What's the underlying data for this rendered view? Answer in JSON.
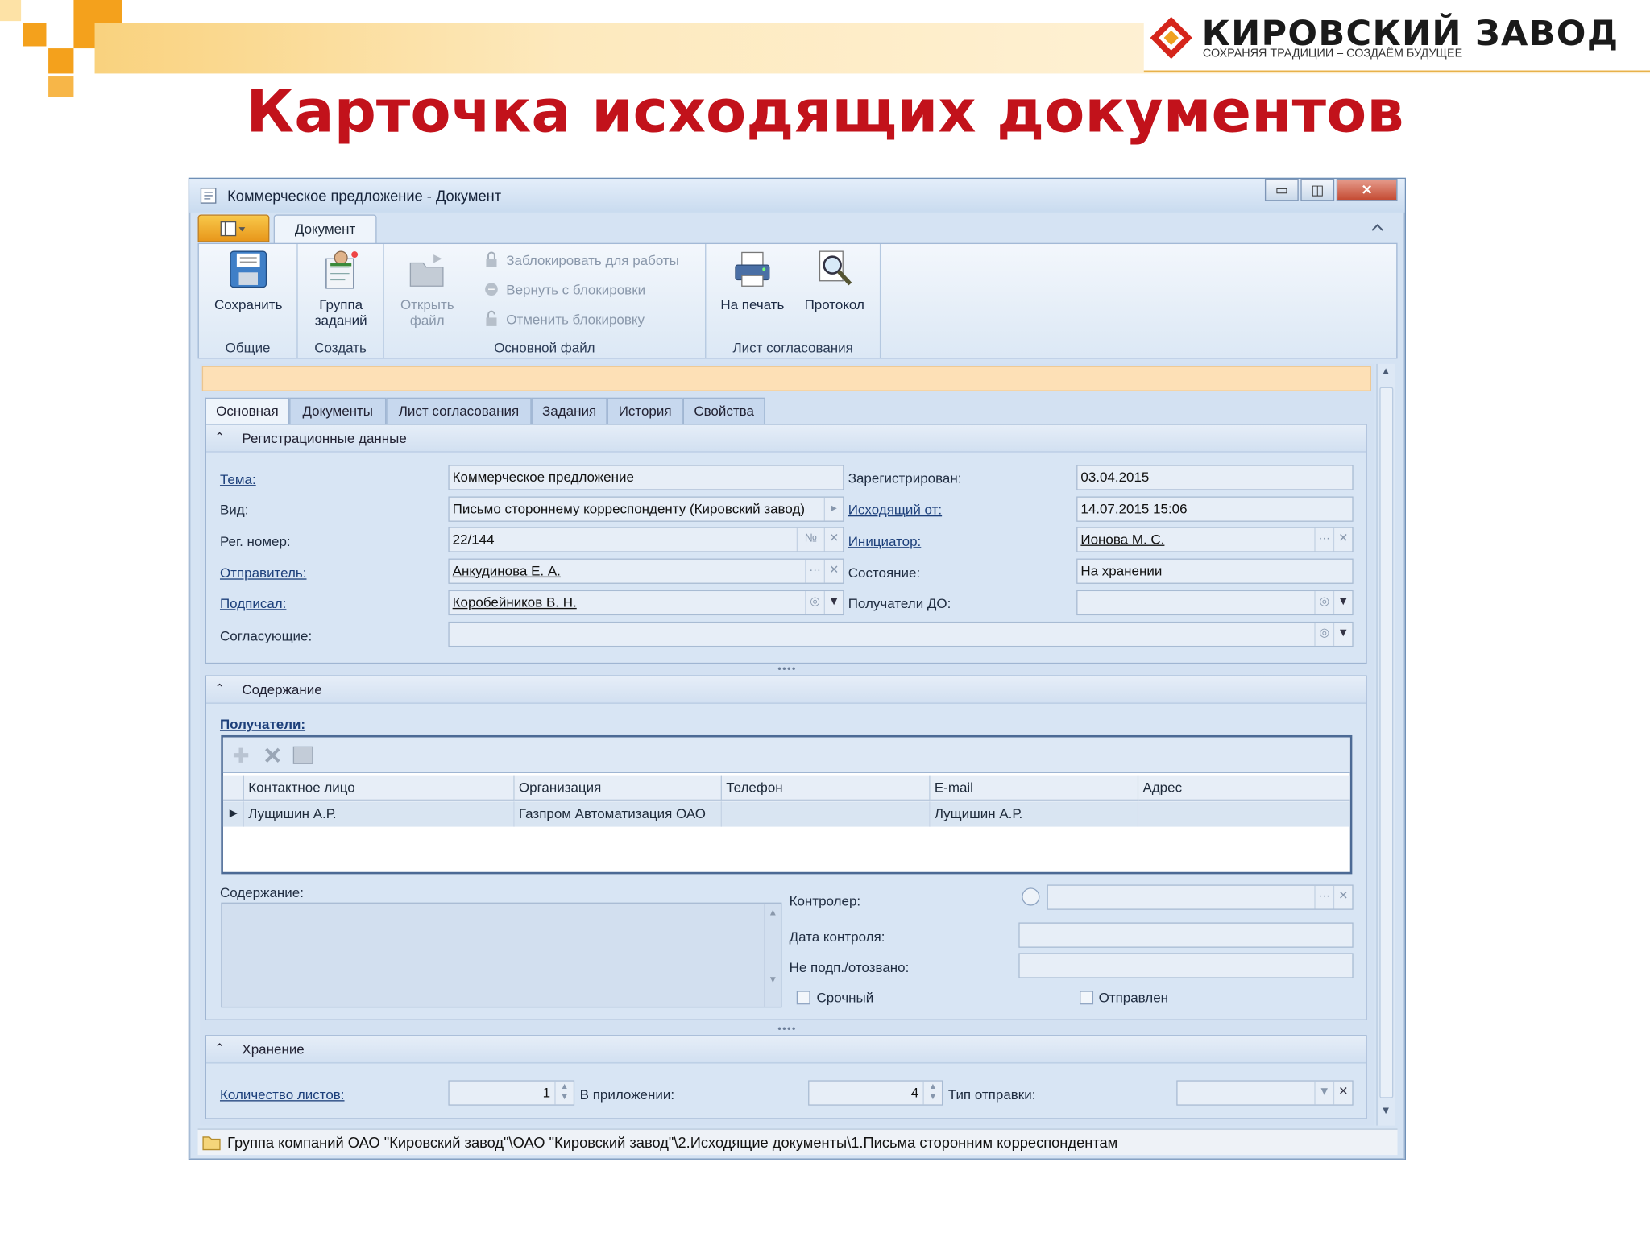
{
  "slide": {
    "title": "Карточка исходящих документов",
    "logo_name": "КИРОВСКИЙ ЗАВОД",
    "logo_tagline": "СОХРАНЯЯ ТРАДИЦИИ – СОЗДАЁМ БУДУЩЕЕ",
    "accent_color": "#c2121b"
  },
  "window": {
    "title": "Коммерческое предложение - Документ",
    "controls": {
      "minimize": "▭",
      "maximize": "◫",
      "close": "✕"
    }
  },
  "ribbon": {
    "tab": "Документ",
    "groups": {
      "general": {
        "label": "Общие",
        "save": "Сохранить"
      },
      "create": {
        "label": "Создать",
        "task_group": "Группа заданий"
      },
      "main_file": {
        "label": "Основной файл",
        "open_file": "Открыть файл",
        "lock": "Заблокировать для работы",
        "return_lock": "Вернуть с блокировки",
        "cancel_lock": "Отменить блокировку"
      },
      "approval": {
        "label": "Лист согласования",
        "print": "На печать",
        "protocol": "Протокол"
      }
    }
  },
  "tabs": [
    "Основная",
    "Документы",
    "Лист согласования",
    "Задания",
    "История",
    "Свойства"
  ],
  "registration": {
    "header": "Регистрационные данные",
    "topic_label": "Тема:",
    "topic_value": "Коммерческое предложение",
    "type_label": "Вид:",
    "type_value": "Письмо стороннему корреспонденту (Кировский завод)",
    "regnum_label": "Рег. номер:",
    "regnum_value": "22/144",
    "regnum_btn": "№",
    "sender_label": "Отправитель:",
    "sender_value": "Анкудинова Е. А.",
    "signed_label": "Подписал:",
    "signed_value": "Коробейников В. Н.",
    "approvers_label": "Согласующие:",
    "registered_label": "Зарегистрирован:",
    "registered_value": "03.04.2015",
    "outgoing_label": "Исходящий от:",
    "outgoing_value": "14.07.2015 15:06",
    "initiator_label": "Инициатор:",
    "initiator_value": "Ионова М. С.",
    "state_label": "Состояние:",
    "state_value": "На хранении",
    "recipients_do_label": "Получатели ДО:"
  },
  "content": {
    "header": "Содержание",
    "recipients_label": "Получатели:",
    "columns": [
      "Контактное лицо",
      "Организация",
      "Телефон",
      "E-mail",
      "Адрес"
    ],
    "rows": [
      [
        "Лущишин А.Р.",
        "Газпром Автоматизация ОАО",
        "",
        "Лущишин А.Р.",
        ""
      ]
    ],
    "content_label": "Содержание:",
    "controller_label": "Контролер:",
    "control_date_label": "Дата контроля:",
    "not_signed_label": "Не подп./отозвано:",
    "urgent_label": "Срочный",
    "sent_label": "Отправлен"
  },
  "storage": {
    "header": "Хранение",
    "sheets_label": "Количество листов:",
    "sheets_value": "1",
    "attachment_label": "В приложении:",
    "attachment_value": "4",
    "send_type_label": "Тип отправки:"
  },
  "status": {
    "path": "Группа компаний ОАО \"Кировский завод\"\\ОАО \"Кировский завод\"\\2.Исходящие документы\\1.Письма сторонним корреспондентам"
  }
}
